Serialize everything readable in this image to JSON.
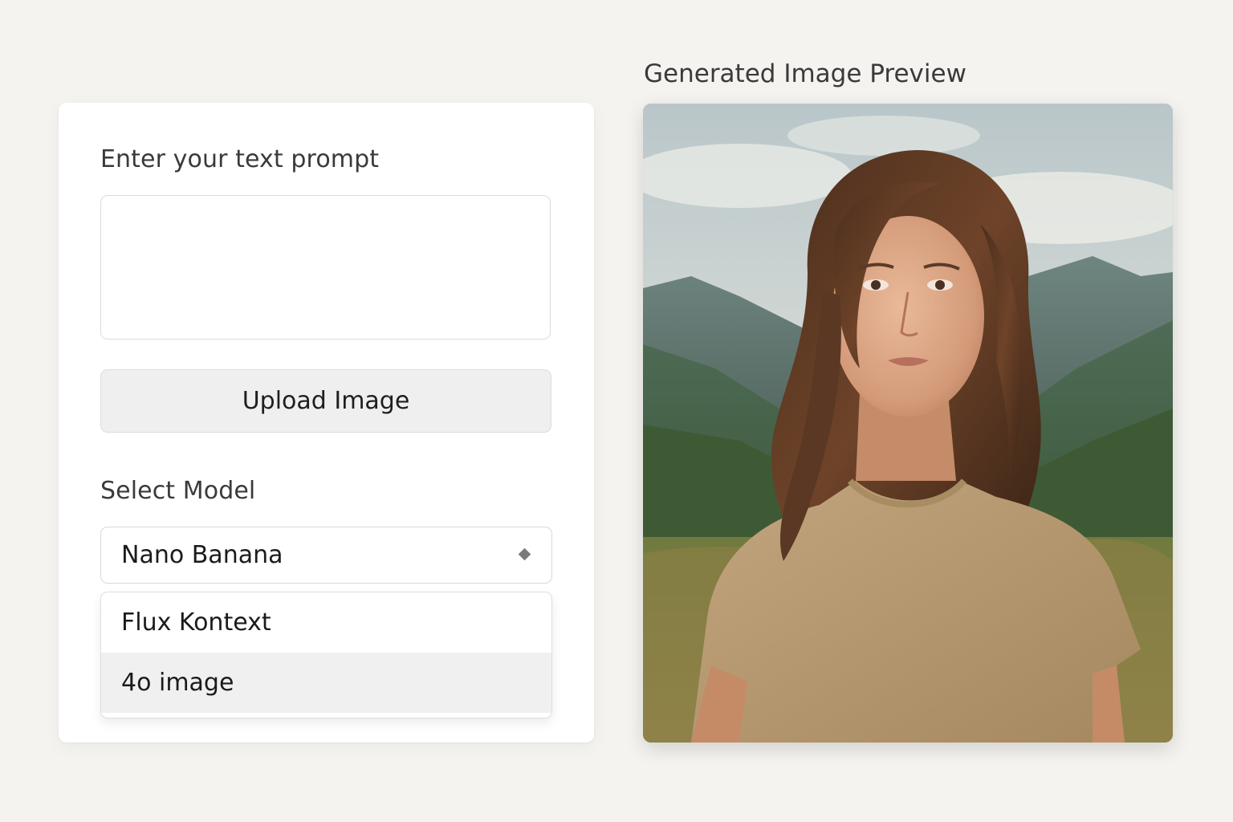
{
  "prompt": {
    "label": "Enter your text prompt",
    "value": "",
    "placeholder": ""
  },
  "upload": {
    "label": "Upload Image"
  },
  "model": {
    "label": "Select Model",
    "selected": "Nano Banana",
    "arrow_icon": "select-arrow-icon",
    "options": [
      "Flux Kontext",
      "4o image"
    ],
    "highlighted_option": "4o image"
  },
  "preview": {
    "title": "Generated Image Preview",
    "image_subject": "portrait-photo"
  },
  "colors": {
    "background": "#f4f3ef",
    "panel": "#ffffff",
    "button": "#efefef",
    "highlight": "#f0f0f0"
  }
}
